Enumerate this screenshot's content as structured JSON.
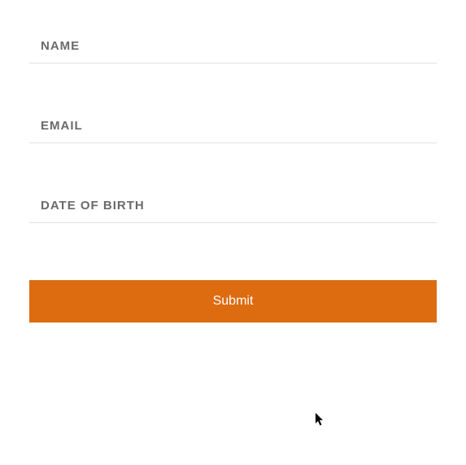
{
  "form": {
    "fields": {
      "name": {
        "placeholder": "NAME",
        "value": ""
      },
      "email": {
        "placeholder": "EMAIL",
        "value": ""
      },
      "dob": {
        "placeholder": "DATE OF BIRTH",
        "value": ""
      }
    },
    "submit_label": "Submit"
  },
  "colors": {
    "accent": "#dd6b10",
    "text": "#6a6a6a",
    "border": "#e0e0e0"
  }
}
